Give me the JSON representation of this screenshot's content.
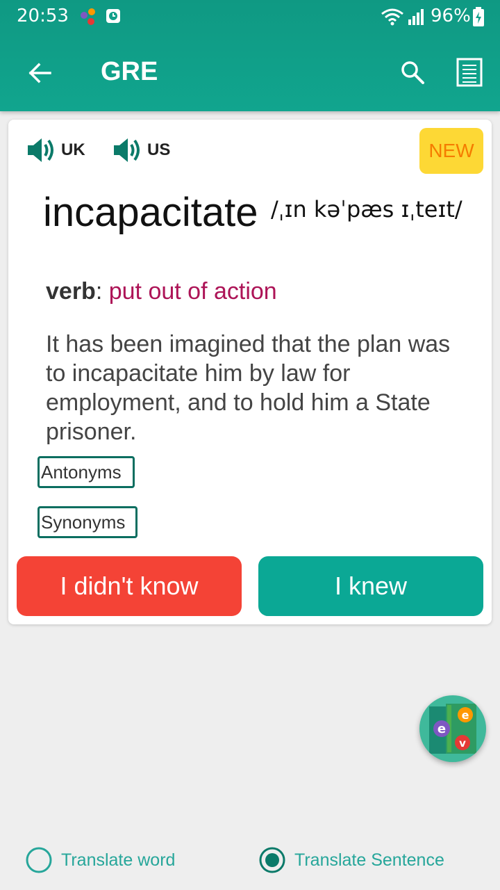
{
  "status_bar": {
    "time": "20:53",
    "battery": "96%"
  },
  "toolbar": {
    "title": "GRE",
    "icons": [
      "back-arrow-icon",
      "search-icon",
      "list-icon"
    ]
  },
  "card": {
    "audio_uk_label": "UK",
    "audio_us_label": "US",
    "badge": "NEW",
    "word": "incapacitate",
    "phonetic": "/ˌɪn kəˈpæs ɪˌteɪt/",
    "part_of_speech": "verb",
    "colon": ": ",
    "meaning": "put out of action",
    "example": "It has been imagined that the plan was to incapacitate him by law for employment, and to hold him a State prisoner.",
    "antonyms_label": "Antonyms",
    "synonyms_label": "Synonyms",
    "didnt_know_label": "I didn't know",
    "knew_label": "I knew"
  },
  "bottom_options": {
    "translate_word": "Translate word",
    "translate_sentence": "Translate Sentence",
    "selected": "translate_sentence"
  },
  "colors": {
    "primary": "#11a58e",
    "danger": "#f44336",
    "meaning": "#ad1457",
    "badge_bg": "#fdd835",
    "badge_text": "#f57c00"
  }
}
